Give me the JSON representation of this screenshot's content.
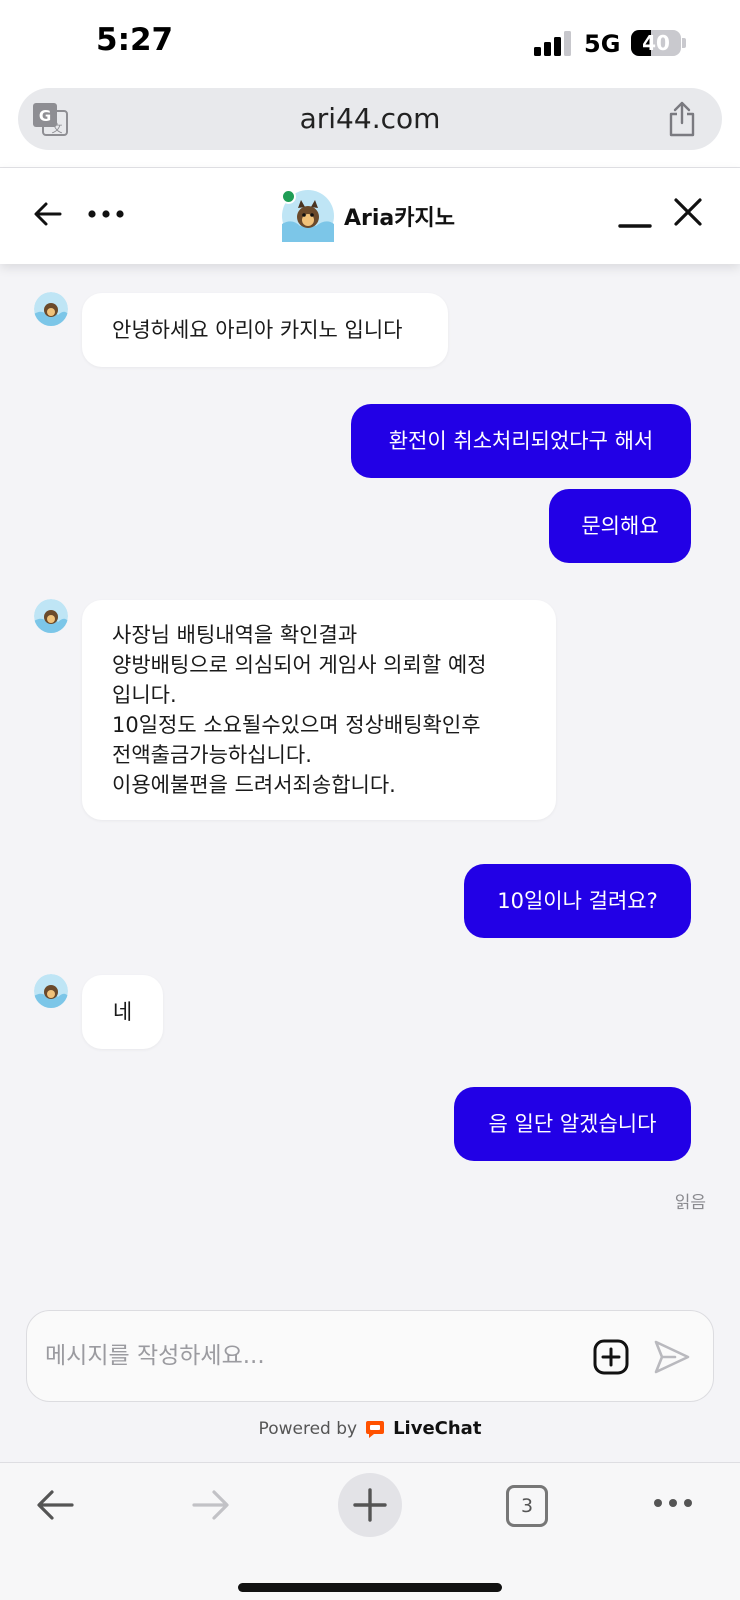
{
  "status_bar": {
    "time": "5:27",
    "network": "5G",
    "battery_percent": "40",
    "battery_level": 0.4,
    "signal_bars_active": 3
  },
  "browser": {
    "url": "ari44.com",
    "translate_icon": "translate-icon",
    "share_icon": "share-icon"
  },
  "chat_header": {
    "title": "Aria카지노",
    "status": "online",
    "online_color": "#1f9d55"
  },
  "messages": [
    {
      "sender": "agent",
      "text": "안녕하세요 아리아 카지노 입니다"
    },
    {
      "sender": "user",
      "text": "환전이 취소처리되었다구 해서"
    },
    {
      "sender": "user",
      "text": "문의해요"
    },
    {
      "sender": "agent",
      "lines": [
        "사장님 배팅내역을 확인결과",
        "양방배팅으로 의심되어 게임사 의뢰할 예정",
        "입니다.",
        "10일정도 소요될수있으며 정상배팅확인후",
        "전액출금가능하십니다.",
        "이용에불편을 드려서죄송합니다."
      ]
    },
    {
      "sender": "user",
      "text": "10일이나 걸려요?"
    },
    {
      "sender": "agent",
      "text": "네"
    },
    {
      "sender": "user",
      "text": "음 일단 알겠습니다"
    }
  ],
  "read_receipt": "읽음",
  "composer": {
    "placeholder": "메시지를 작성하세요..."
  },
  "footer": {
    "powered_by": "Powered by",
    "brand": "LiveChat",
    "brand_color": "#ff5100"
  },
  "toolbar": {
    "tab_count": "3"
  },
  "colors": {
    "user_bubble": "#2200e6",
    "agent_bubble": "#ffffff",
    "background": "#f4f4f7"
  }
}
